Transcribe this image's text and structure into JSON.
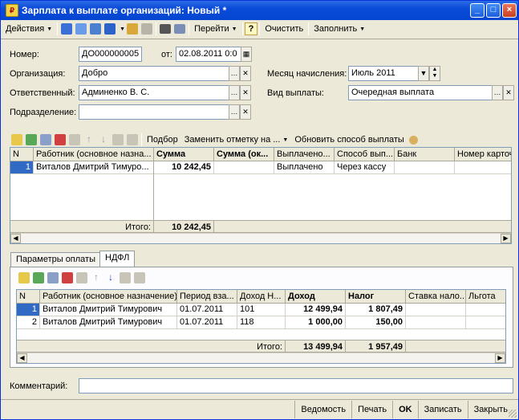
{
  "window": {
    "title": "Зарплата к выплате организаций: Новый *",
    "min": "_",
    "max": "□",
    "close": "×"
  },
  "toolbar": {
    "actions": "Действия",
    "goto": "Перейти",
    "help": "?",
    "clear": "Очистить",
    "fill": "Заполнить"
  },
  "header": {
    "number_label": "Номер:",
    "number_value": "ДО000000005",
    "from_label": "от:",
    "date_value": "02.08.2011  0:0",
    "org_label": "Организация:",
    "org_value": "Добро",
    "month_label": "Месяц начисления:",
    "month_value": "Июль 2011",
    "resp_label": "Ответственный:",
    "resp_value": "Админенко В. С.",
    "paytype_label": "Вид выплаты:",
    "paytype_value": "Очередная выплата",
    "dept_label": "Подразделение:",
    "dept_value": ""
  },
  "subtoolbar": {
    "pick": "Подбор",
    "replace": "Заменить отметку на ...",
    "update": "Обновить способ выплаты"
  },
  "table1": {
    "headers": [
      "N",
      "Работник (основное назна...",
      "Сумма",
      "Сумма (ок...",
      "Выплачено...",
      "Способ вып...",
      "Банк",
      "Номер карточ"
    ],
    "rows": [
      [
        "1",
        "Виталов Дмитрий Тимуро...",
        "10 242,45",
        "",
        "Выплачено",
        "Через кассу",
        "",
        ""
      ]
    ],
    "total_label": "Итого:",
    "total_value": "10 242,45"
  },
  "tabs": {
    "payment_params": "Параметры оплаты",
    "ndfl": "НДФЛ"
  },
  "table2": {
    "headers": [
      "N",
      "Работник (основное назначение)",
      "Период вза...",
      "Доход Н...",
      "Доход",
      "Налог",
      "Ставка нало...",
      "Льгота"
    ],
    "rows": [
      [
        "1",
        "Виталов Дмитрий Тимурович",
        "01.07.2011",
        "101",
        "12 499,94",
        "1 807,49",
        "",
        ""
      ],
      [
        "2",
        "Виталов Дмитрий Тимурович",
        "01.07.2011",
        "118",
        "1 000,00",
        "150,00",
        "",
        ""
      ]
    ],
    "total_label": "Итого:",
    "total_income": "13 499,94",
    "total_tax": "1 957,49"
  },
  "comment": {
    "label": "Комментарий:",
    "value": ""
  },
  "footer": {
    "report": "Ведомость",
    "print": "Печать",
    "ok": "OK",
    "save": "Записать",
    "close": "Закрыть"
  },
  "colors": {
    "title_bar": "#0a4ad8",
    "face": "#ece9d8",
    "border": "#7f9db9",
    "selection": "#316ac5"
  }
}
